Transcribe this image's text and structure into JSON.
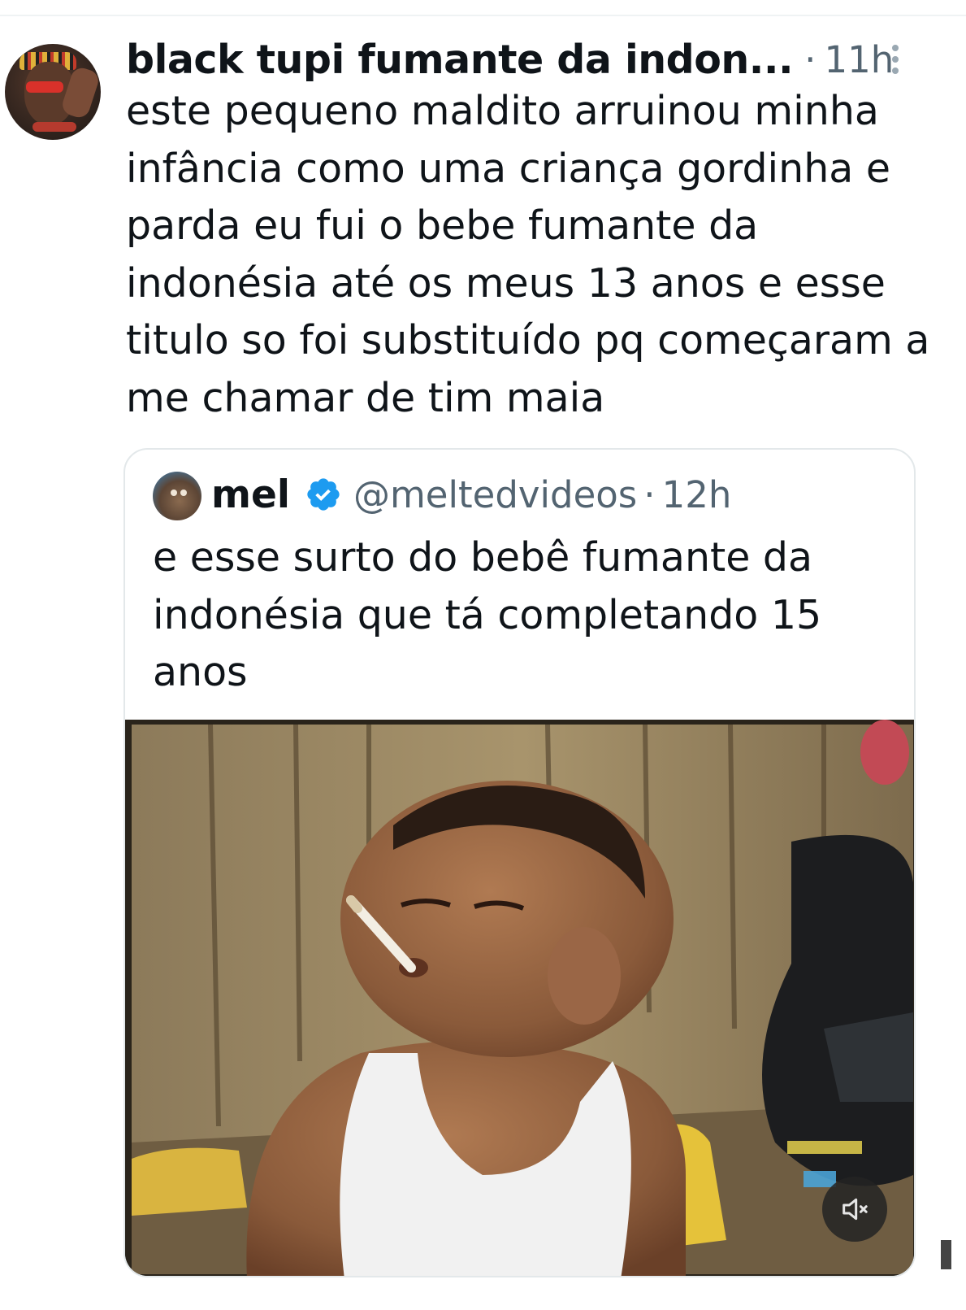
{
  "tweet": {
    "author_name": "black tupi fumante da indon...",
    "separator": "·",
    "time": "11h",
    "text": "este pequeno maldito arruinou minha infância como uma criança gordinha e parda eu fui o bebe fumante da indonésia até os meus 13 anos e esse titulo so foi substituído pq começaram a me chamar de tim maia",
    "more_icon": "more-vertical-icon"
  },
  "quoted_tweet": {
    "author_name": "mel",
    "verified_icon": "verified-badge-icon",
    "handle": "@meltedvideos",
    "separator": "·",
    "time": "12h",
    "text": "e esse surto do bebê fumante da indonésia que tá completando 15 anos",
    "media": {
      "type": "video",
      "mute_icon": "speaker-muted-icon"
    }
  },
  "colors": {
    "text_primary": "#0f1419",
    "text_secondary": "#536471",
    "verified_blue": "#1d9bf0",
    "border": "#e3e8ea"
  }
}
